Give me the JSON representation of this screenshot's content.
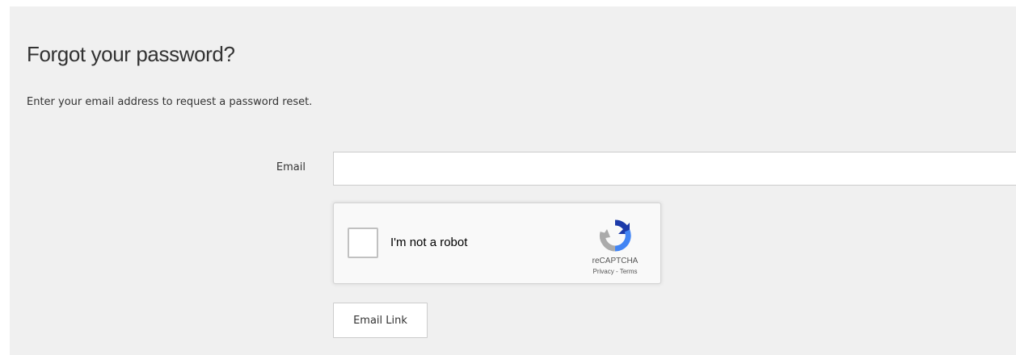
{
  "page": {
    "title": "Forgot your password?",
    "instructions": "Enter your email address to request a password reset."
  },
  "form": {
    "email_label": "Email",
    "email_value": "",
    "email_placeholder": "",
    "submit_label": "Email Link"
  },
  "recaptcha": {
    "checkbox_label": "I'm not a robot",
    "brand": "reCAPTCHA",
    "privacy_link": "Privacy",
    "separator": " - ",
    "terms_link": "Terms",
    "icon": "recaptcha-logo-icon",
    "checked": false
  },
  "colors": {
    "panel_background": "#f0f0f0",
    "text": "#333333",
    "recaptcha_blue_dark": "#1c3aa9",
    "recaptcha_blue_light": "#4285f4",
    "recaptcha_gray": "#ababab"
  }
}
